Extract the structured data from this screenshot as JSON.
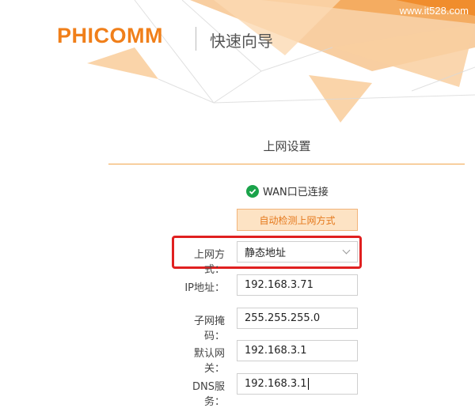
{
  "watermark": "www.it528.com",
  "header": {
    "logo": "PHICOMM",
    "subtitle": "快速向导"
  },
  "section": {
    "title": "上网设置"
  },
  "status": {
    "text": "WAN口已连接",
    "color": "#1aa34a"
  },
  "detect_button": {
    "label": "自动检测上网方式"
  },
  "form": {
    "method": {
      "label": "上网方式：",
      "value": "静态地址"
    },
    "ip": {
      "label": "IP地址：",
      "value": "192.168.3.71"
    },
    "mask": {
      "label": "子网掩码：",
      "value": "255.255.255.0"
    },
    "gateway": {
      "label": "默认网关：",
      "value": "192.168.3.1"
    },
    "dns": {
      "label": "DNS服务：",
      "value": "192.168.3.1"
    }
  },
  "colors": {
    "brand": "#f07f1a",
    "highlight": "#e02020",
    "button_bg": "#fde3c4"
  }
}
